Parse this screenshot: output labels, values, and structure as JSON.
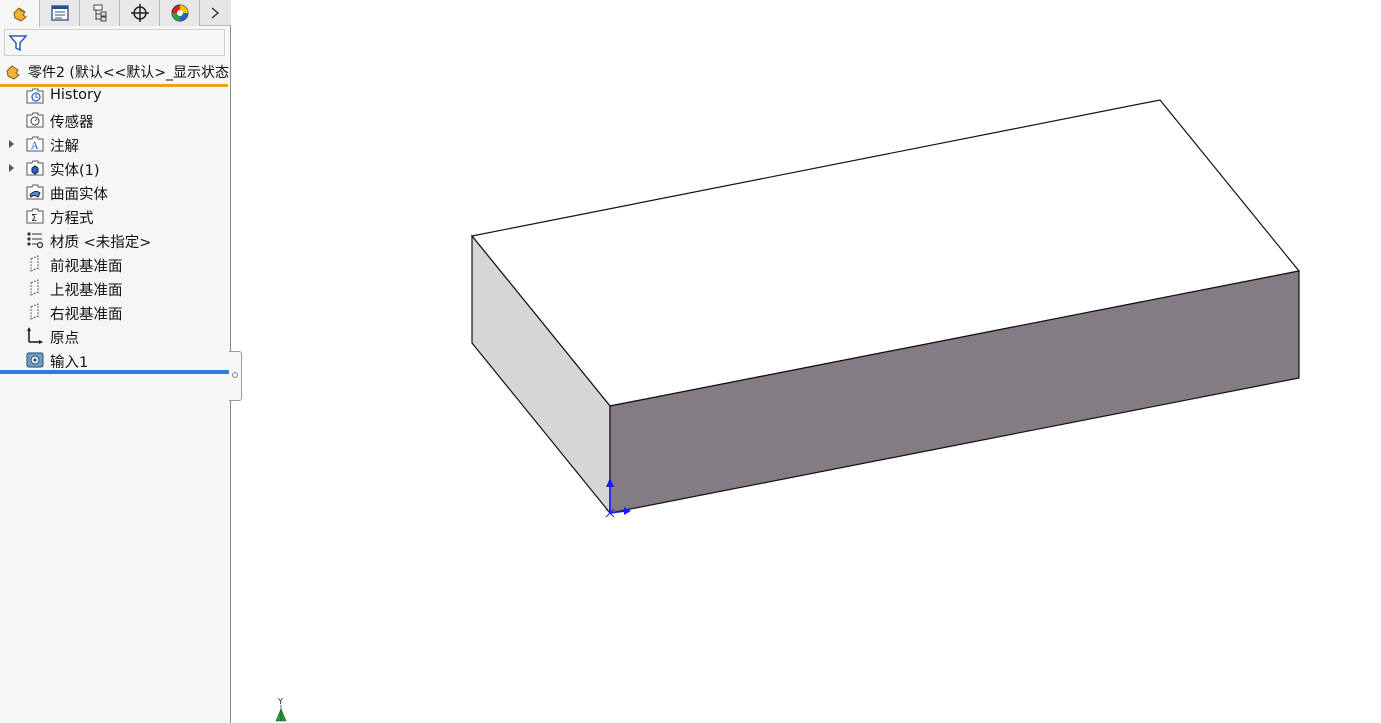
{
  "feature_tree": {
    "root_label": "零件2  (默认<<默认>_显示状态",
    "items": [
      {
        "label": "History",
        "icon": "history-folder-icon",
        "expandable": false
      },
      {
        "label": "传感器",
        "icon": "sensors-folder-icon",
        "expandable": false
      },
      {
        "label": "注解",
        "icon": "annotations-folder-icon",
        "expandable": true
      },
      {
        "label": "实体(1)",
        "icon": "solid-bodies-folder-icon",
        "expandable": true
      },
      {
        "label": "曲面实体",
        "icon": "surface-bodies-folder-icon",
        "expandable": false
      },
      {
        "label": "方程式",
        "icon": "equations-folder-icon",
        "expandable": false
      },
      {
        "label": "材质 <未指定>",
        "icon": "material-icon",
        "expandable": false
      },
      {
        "label": "前视基准面",
        "icon": "plane-icon",
        "expandable": false
      },
      {
        "label": "上视基准面",
        "icon": "plane-icon",
        "expandable": false
      },
      {
        "label": "右视基准面",
        "icon": "plane-icon",
        "expandable": false
      },
      {
        "label": "原点",
        "icon": "origin-icon",
        "expandable": false
      },
      {
        "label": "输入1",
        "icon": "imported-body-icon",
        "expandable": false
      }
    ]
  },
  "tabs": [
    {
      "name": "feature-manager-tab",
      "icon": "part-icon"
    },
    {
      "name": "property-manager-tab",
      "icon": "property-icon"
    },
    {
      "name": "configuration-manager-tab",
      "icon": "configuration-icon"
    },
    {
      "name": "dimxpert-manager-tab",
      "icon": "crosshair-icon"
    },
    {
      "name": "display-manager-tab",
      "icon": "appearance-icon"
    }
  ],
  "colors": {
    "accent_orange": "#e8a41c",
    "rollback_blue": "#2f7fd6",
    "top_face": "#ffffff",
    "left_face": "#d6d6d6",
    "front_face": "#837c83",
    "triad_y": "#2a9a3a"
  },
  "triad_label": "Y"
}
